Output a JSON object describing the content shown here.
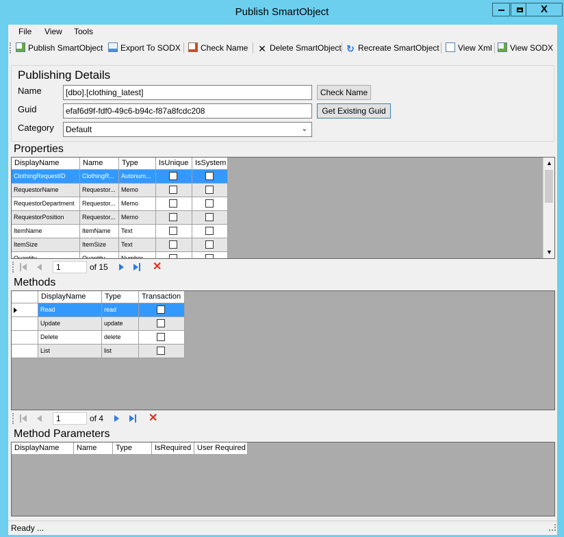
{
  "window": {
    "title": "Publish SmartObject",
    "minimize": "▬",
    "maximize": "☐",
    "close": "X"
  },
  "menu": [
    "File",
    "View",
    "Tools"
  ],
  "toolbar": {
    "publish": "Publish SmartObject",
    "export": "Export To SODX",
    "check_name": "Check Name",
    "delete": "Delete SmartObject",
    "recreate": "Recreate SmartObject",
    "view_xml": "View Xml",
    "view_sodx": "View SODX"
  },
  "publishing": {
    "title": "Publishing Details",
    "name_label": "Name",
    "name_value": "[dbo].[clothing_latest]",
    "check_name_button": "Check Name",
    "guid_label": "Guid",
    "guid_value": "efaf6d9f-fdf0-49c6-b94c-f87a8fcdc208",
    "get_guid_button": "Get Existing Guid",
    "category_label": "Category",
    "category_value": "Default"
  },
  "properties": {
    "title": "Properties",
    "columns": [
      "DisplayName",
      "Name",
      "Type",
      "IsUnique",
      "IsSystem"
    ],
    "rows": [
      [
        "ClothingRequestID",
        "ClothingR...",
        "Autonum..."
      ],
      [
        "RequestorName",
        "Requestor...",
        "Memo"
      ],
      [
        "RequestorDepartment",
        "Requestor...",
        "Memo"
      ],
      [
        "RequestorPosition",
        "Requestor...",
        "Memo"
      ],
      [
        "ItemName",
        "ItemName",
        "Text"
      ],
      [
        "ItemSize",
        "ItemSize",
        "Text"
      ],
      [
        "Quantity",
        "Quantity",
        "Number"
      ]
    ],
    "nav_position": "1",
    "nav_count": "of 15"
  },
  "methods": {
    "title": "Methods",
    "columns": [
      "DisplayName",
      "Type",
      "Transaction"
    ],
    "rows": [
      [
        "Read",
        "read"
      ],
      [
        "Update",
        "update"
      ],
      [
        "Delete",
        "delete"
      ],
      [
        "List",
        "list"
      ]
    ],
    "nav_position": "1",
    "nav_count": "of 4"
  },
  "method_parameters": {
    "title": "Method Parameters",
    "columns": [
      "DisplayName",
      "Name",
      "Type",
      "IsRequired",
      "User Required"
    ]
  },
  "status": "Ready ...",
  "colors": {
    "titlebar": "#6ccfee",
    "selection": "#3399ff",
    "grid_bg": "#ababab"
  },
  "icons": [
    "publish-icon",
    "export-icon",
    "check-name-icon",
    "delete-icon",
    "recreate-icon",
    "view-xml-icon",
    "view-sodx-icon"
  ]
}
